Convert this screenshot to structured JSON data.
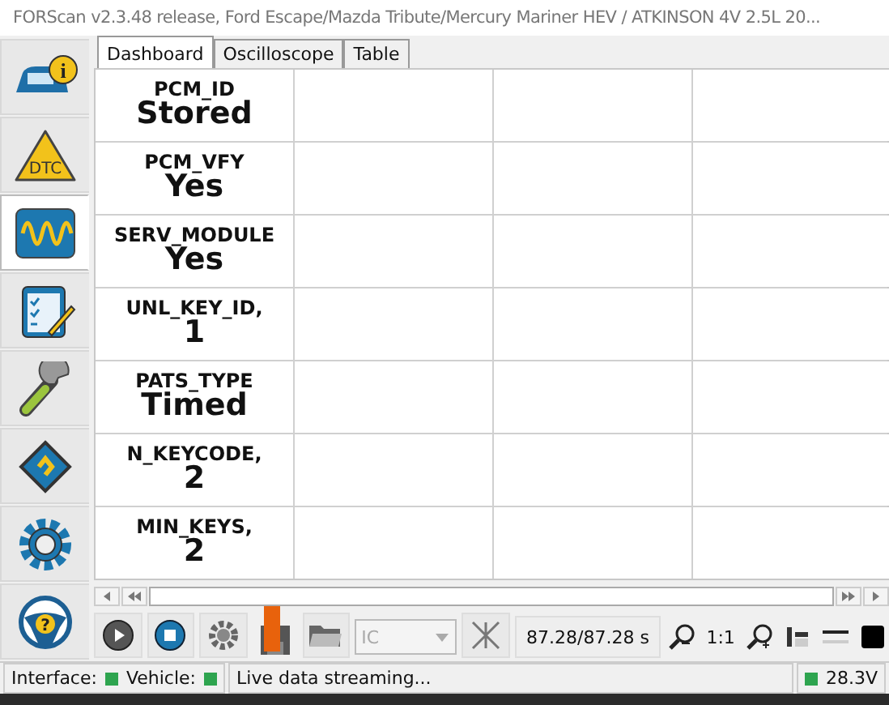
{
  "window": {
    "title": "FORScan v2.3.48 release, Ford Escape/Mazda Tribute/Mercury Mariner HEV / ATKINSON 4V 2.5L 20..."
  },
  "sidebar": [
    {
      "kind": "info",
      "glyph": "i",
      "selected": false
    },
    {
      "kind": "dtc",
      "glyph": "DTC",
      "selected": false
    },
    {
      "kind": "oscilloscope",
      "selected": true
    },
    {
      "kind": "checklist",
      "selected": false
    },
    {
      "kind": "wrench",
      "selected": false
    },
    {
      "kind": "chip",
      "selected": false
    },
    {
      "kind": "gear",
      "selected": false
    },
    {
      "kind": "help",
      "glyph": "?",
      "selected": false
    }
  ],
  "tabs": [
    {
      "label": "Dashboard",
      "selected": true
    },
    {
      "label": "Oscilloscope",
      "selected": false
    },
    {
      "label": "Table",
      "selected": false
    }
  ],
  "gauges": [
    {
      "name": "PCM_ID",
      "value": "Stored"
    },
    {
      "name": "PCM_VFY",
      "value": "Yes"
    },
    {
      "name": "SERV_MODULE",
      "value": "Yes"
    },
    {
      "name": "UNL_KEY_ID,",
      "value": "1"
    },
    {
      "name": "PATS_TYPE",
      "value": "Timed"
    },
    {
      "name": "N_KEYCODE,",
      "value": "2"
    },
    {
      "name": "MIN_KEYS,",
      "value": "2"
    }
  ],
  "toolbar": {
    "module_combo": {
      "value": "IC",
      "disabled": true
    },
    "time": "87.28/87.28 s",
    "zoom": "1:1"
  },
  "status_bar": {
    "items": [
      {
        "label": "Interface:",
        "color": "#2ea44f"
      },
      {
        "label": "Vehicle:",
        "color": "#2ea44f"
      }
    ],
    "message": "Live data streaming...",
    "voltage": {
      "value": "28.3V",
      "color": "#2ea44f"
    }
  }
}
